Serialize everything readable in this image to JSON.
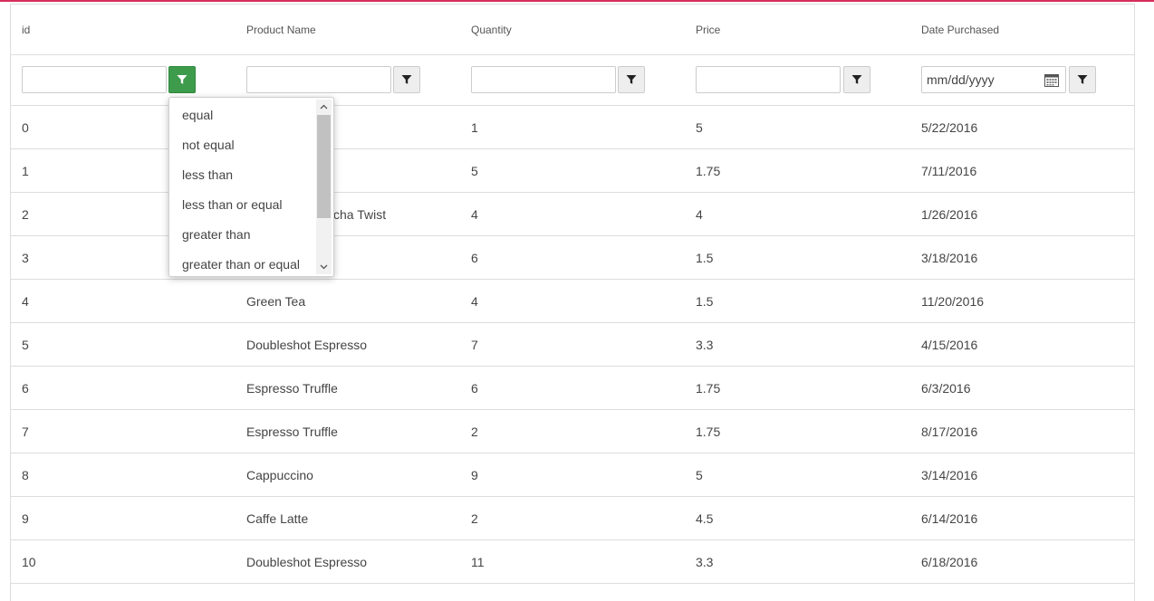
{
  "columns": [
    "id",
    "Product Name",
    "Quantity",
    "Price",
    "Date Purchased"
  ],
  "filters": {
    "date_placeholder": "mm/dd/yyyy"
  },
  "operator_menu": {
    "items": [
      "equal",
      "not equal",
      "less than",
      "less than or equal",
      "greater than",
      "greater than or equal"
    ]
  },
  "rows": [
    {
      "id": "0",
      "product": "",
      "quantity": "1",
      "price": "5",
      "date": "5/22/2016"
    },
    {
      "id": "1",
      "product": "e",
      "quantity": "5",
      "price": "1.75",
      "date": "7/11/2016"
    },
    {
      "id": "2",
      "product": "cha Twist",
      "quantity": "4",
      "price": "4",
      "date": "1/26/2016"
    },
    {
      "id": "3",
      "product": "",
      "quantity": "6",
      "price": "1.5",
      "date": "3/18/2016"
    },
    {
      "id": "4",
      "product": "Green Tea",
      "quantity": "4",
      "price": "1.5",
      "date": "11/20/2016"
    },
    {
      "id": "5",
      "product": "Doubleshot Espresso",
      "quantity": "7",
      "price": "3.3",
      "date": "4/15/2016"
    },
    {
      "id": "6",
      "product": "Espresso Truffle",
      "quantity": "6",
      "price": "1.75",
      "date": "6/3/2016"
    },
    {
      "id": "7",
      "product": "Espresso Truffle",
      "quantity": "2",
      "price": "1.75",
      "date": "8/17/2016"
    },
    {
      "id": "8",
      "product": "Cappuccino",
      "quantity": "9",
      "price": "5",
      "date": "3/14/2016"
    },
    {
      "id": "9",
      "product": "Caffe Latte",
      "quantity": "2",
      "price": "4.5",
      "date": "6/14/2016"
    },
    {
      "id": "10",
      "product": "Doubleshot Espresso",
      "quantity": "11",
      "price": "3.3",
      "date": "6/18/2016"
    }
  ],
  "icons": {
    "filter": "filter-icon",
    "calendar": "calendar-icon"
  },
  "colors": {
    "accent": "#d62d5a",
    "active_filter": "#3e9b4c"
  }
}
